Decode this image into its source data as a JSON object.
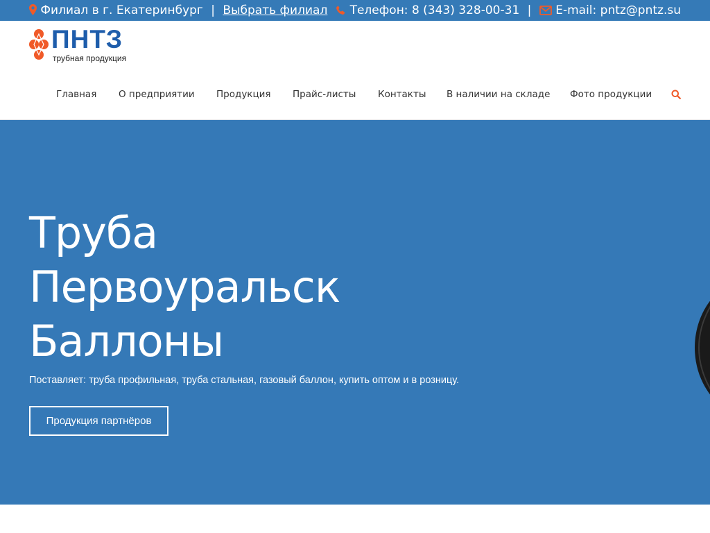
{
  "topbar": {
    "branch_text": "Филиал в г. Екатеринбург",
    "divider": "|",
    "select_branch": "Выбрать филиал",
    "phone": "Телефон: 8 (343) 328-00-31",
    "email": "E-mail: pntz@pntz.su",
    "icons": [
      "map-marker-icon",
      "phone-icon",
      "envelope-icon"
    ],
    "icon_color": "#f05a28"
  },
  "logo": {
    "name": "ПНТЗ",
    "subtitle": "трубная продукция",
    "brand_color": "#1e5dab",
    "accent_color": "#f05a28"
  },
  "nav": {
    "items": [
      "Главная",
      "О предприятии",
      "Продукция",
      "Прайс-листы",
      "Контакты",
      "В наличии на складе",
      "Фото продукции"
    ],
    "search_icon": "search-icon"
  },
  "hero": {
    "title_lines": [
      "Труба",
      "Первоуральск",
      "Баллоны"
    ],
    "description": "Поставляет: труба профильная, труба стальная, газовый баллон, купить оптом и в розницу.",
    "button_label": "Продукция партнёров",
    "background": "#3579b7"
  }
}
